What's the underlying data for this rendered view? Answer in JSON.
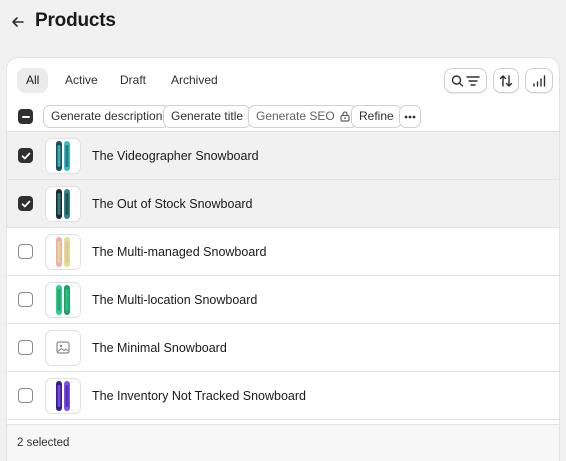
{
  "page": {
    "title": "Products",
    "back_icon": "arrow-left-icon"
  },
  "tabs": [
    {
      "label": "All",
      "active": true
    },
    {
      "label": "Active",
      "active": false
    },
    {
      "label": "Draft",
      "active": false
    },
    {
      "label": "Archived",
      "active": false
    }
  ],
  "toolbar": {
    "search_filter_icon": "search-filter-icon",
    "sort_icon": "sort-icon",
    "columns_icon": "bar-chart-icon"
  },
  "bulk_actions": {
    "select_all_state": "indeterminate",
    "generate_description": "Generate description",
    "generate_title": "Generate title",
    "generate_seo": "Generate SEO",
    "generate_seo_icon": "lock-icon",
    "refine": "Refine",
    "more_icon": "more-horizontal-icon"
  },
  "products": [
    {
      "title": "The Videographer Snowboard",
      "selected": true,
      "colors": [
        "#1e4c5a",
        "#3dbbc4"
      ],
      "placeholder": false
    },
    {
      "title": "The Out of Stock Snowboard",
      "selected": true,
      "colors": [
        "#1f2a30",
        "#2f8a86"
      ],
      "placeholder": false
    },
    {
      "title": "The Multi-managed Snowboard",
      "selected": false,
      "colors": [
        "#f4a9b2",
        "#d9e58a"
      ],
      "placeholder": false
    },
    {
      "title": "The Multi-location Snowboard",
      "selected": false,
      "colors": [
        "#2fd08c",
        "#1f9e6c"
      ],
      "placeholder": false
    },
    {
      "title": "The Minimal Snowboard",
      "selected": false,
      "colors": [],
      "placeholder": true
    },
    {
      "title": "The Inventory Not Tracked Snowboard",
      "selected": false,
      "colors": [
        "#3a1d8c",
        "#7b4ff0"
      ],
      "placeholder": false
    }
  ],
  "footer": {
    "selected_text": "2 selected"
  },
  "colors": {
    "background": "#f1f1f1",
    "card": "#ffffff",
    "selected_row": "#f1f1f1",
    "checkbox_checked": "#303030"
  }
}
